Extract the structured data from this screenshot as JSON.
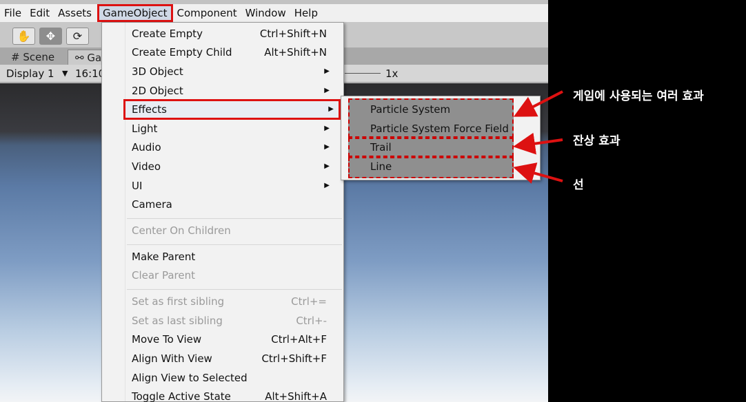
{
  "menubar": [
    "File",
    "Edit",
    "Assets",
    "GameObject",
    "Component",
    "Window",
    "Help"
  ],
  "tabs": {
    "scene": "Scene",
    "game": "Ga"
  },
  "gamebar": {
    "display": "Display 1",
    "aspect": "16:10",
    "scale": "1x"
  },
  "toolbar_icons": [
    "hand-icon",
    "move-icon",
    "rotate-icon"
  ],
  "menu": {
    "create_empty": {
      "label": "Create Empty",
      "shortcut": "Ctrl+Shift+N"
    },
    "create_empty_child": {
      "label": "Create Empty Child",
      "shortcut": "Alt+Shift+N"
    },
    "object_3d": "3D Object",
    "object_2d": "2D Object",
    "effects": "Effects",
    "light": "Light",
    "audio": "Audio",
    "video": "Video",
    "ui": "UI",
    "camera": "Camera",
    "center_on_children": "Center On Children",
    "make_parent": "Make Parent",
    "clear_parent": "Clear Parent",
    "first_sibling": {
      "label": "Set as first sibling",
      "shortcut": "Ctrl+="
    },
    "last_sibling": {
      "label": "Set as last sibling",
      "shortcut": "Ctrl+-"
    },
    "move_to_view": {
      "label": "Move To View",
      "shortcut": "Ctrl+Alt+F"
    },
    "align_with_view": {
      "label": "Align With View",
      "shortcut": "Ctrl+Shift+F"
    },
    "align_view_to_selected": {
      "label": "Align View to Selected"
    },
    "toggle_active": {
      "label": "Toggle Active State",
      "shortcut": "Alt+Shift+A"
    }
  },
  "submenu": {
    "particle_system": "Particle System",
    "particle_force_field": "Particle System Force Field",
    "trail": "Trail",
    "line": "Line"
  },
  "annotations": {
    "effects_note": "게임에 사용되는 여러 효과",
    "trail_note": "잔상 효과",
    "line_note": "선"
  },
  "colors": {
    "highlight_border": "#dd1111",
    "annotation_text": "#ffffff"
  }
}
